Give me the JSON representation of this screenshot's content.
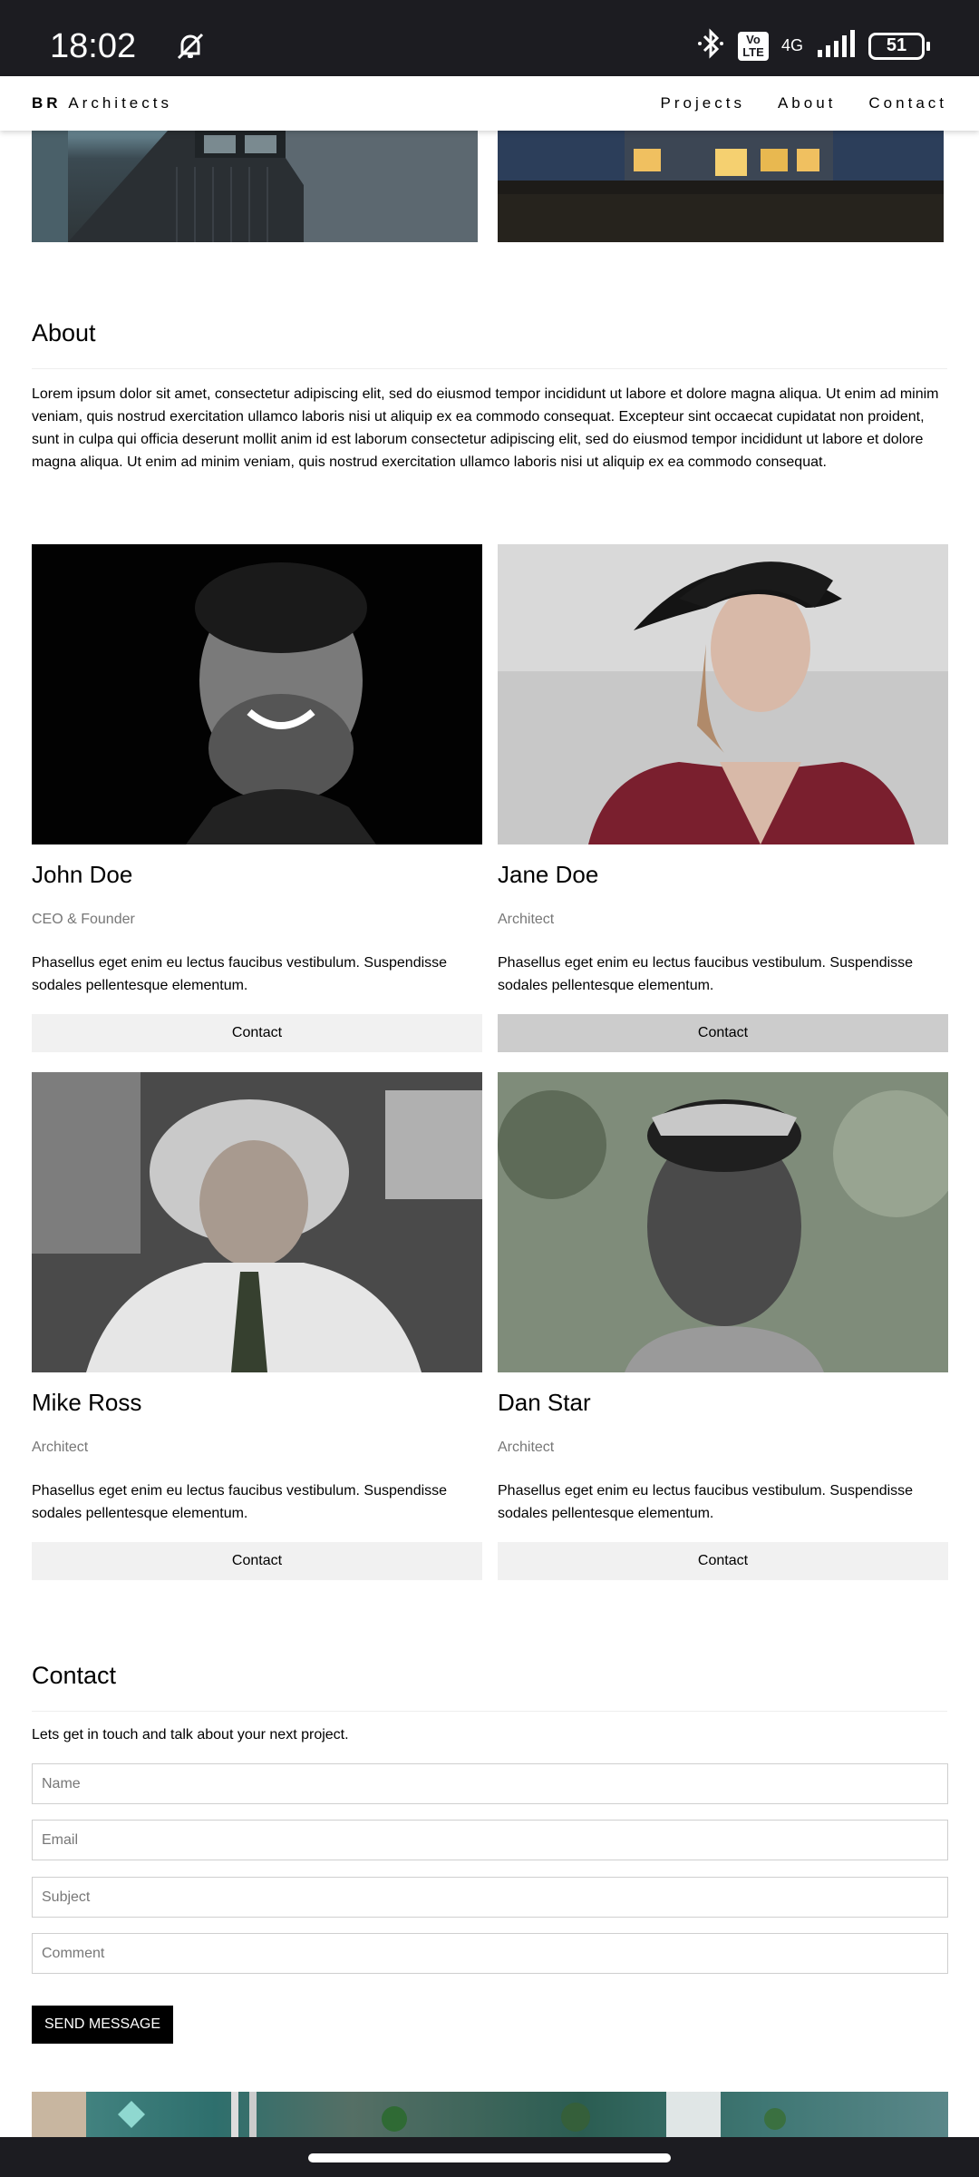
{
  "status_bar": {
    "time": "18:02",
    "network": "4G",
    "volte": "Vo LTE",
    "battery": "51",
    "icons": [
      "bell-off-icon",
      "bluetooth-icon",
      "volte-icon",
      "signal-icon",
      "battery-icon"
    ]
  },
  "nav": {
    "brand_bold": "BR",
    "brand_rest": " Architects",
    "links": [
      "Projects",
      "About",
      "Contact"
    ]
  },
  "about": {
    "title": "About",
    "text": "Lorem ipsum dolor sit amet, consectetur adipiscing elit, sed do eiusmod tempor incididunt ut labore et dolore magna aliqua. Ut enim ad minim veniam, quis nostrud exercitation ullamco laboris nisi ut aliquip ex ea commodo consequat. Excepteur sint occaecat cupidatat non proident, sunt in culpa qui officia deserunt mollit anim id est laborum consectetur adipiscing elit, sed do eiusmod tempor incididunt ut labore et dolore magna aliqua. Ut enim ad minim veniam, quis nostrud exercitation ullamco laboris nisi ut aliquip ex ea commodo consequat."
  },
  "team": [
    {
      "name": "John Doe",
      "role": "CEO & Founder",
      "desc": "Phasellus eget enim eu lectus faucibus vestibulum. Suspendisse sodales pellentesque elementum.",
      "button": "Contact"
    },
    {
      "name": "Jane Doe",
      "role": "Architect",
      "desc": "Phasellus eget enim eu lectus faucibus vestibulum. Suspendisse sodales pellentesque elementum.",
      "button": "Contact"
    },
    {
      "name": "Mike Ross",
      "role": "Architect",
      "desc": "Phasellus eget enim eu lectus faucibus vestibulum. Suspendisse sodales pellentesque elementum.",
      "button": "Contact"
    },
    {
      "name": "Dan Star",
      "role": "Architect",
      "desc": "Phasellus eget enim eu lectus faucibus vestibulum. Suspendisse sodales pellentesque elementum.",
      "button": "Contact"
    }
  ],
  "contact": {
    "title": "Contact",
    "lead": "Lets get in touch and talk about your next project.",
    "placeholders": {
      "name": "Name",
      "email": "Email",
      "subject": "Subject",
      "comment": "Comment"
    },
    "send_label": "SEND MESSAGE"
  }
}
